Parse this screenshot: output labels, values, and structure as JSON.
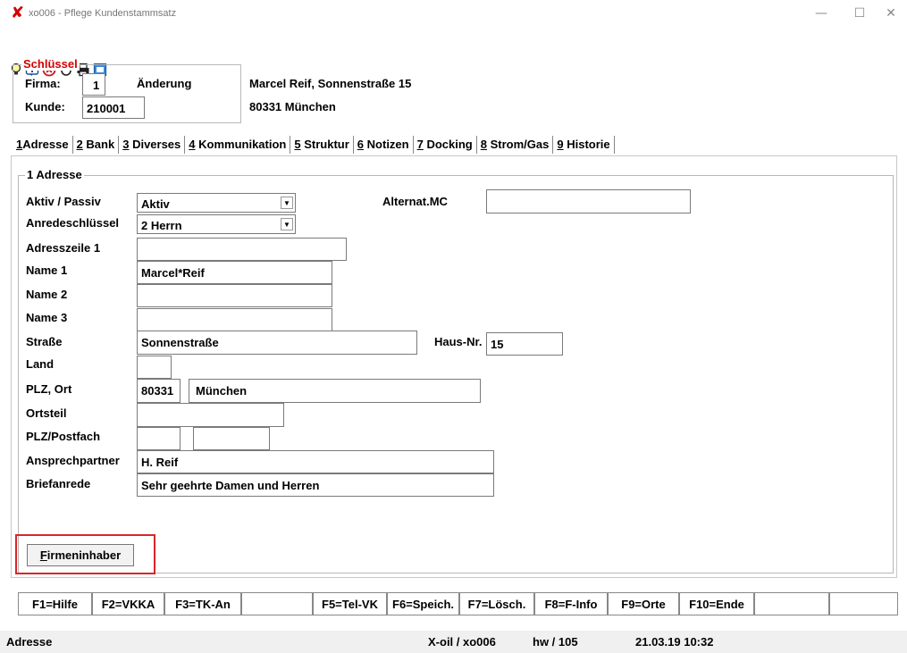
{
  "window": {
    "title": "xo006 - Pflege Kundenstammsatz",
    "minimize": "—",
    "maximize": "☐",
    "close": "✕"
  },
  "toolbar": {
    "icons": [
      "lightbulb-icon",
      "info-icon",
      "cancel-icon",
      "refresh-icon",
      "print-icon",
      "window-icon"
    ]
  },
  "key": {
    "legend": "Schlüssel",
    "firma_label": "Firma:",
    "firma_value": "1",
    "mode": "Änderung",
    "kunde_label": "Kunde:",
    "kunde_value": "210001",
    "customer_line1": "Marcel Reif, Sonnenstraße 15",
    "customer_line2": "80331 München"
  },
  "tabs": [
    {
      "num": "1",
      "label": "Adresse"
    },
    {
      "num": "2",
      "label": "Bank"
    },
    {
      "num": "3",
      "label": "Diverses"
    },
    {
      "num": "4",
      "label": "Kommunikation"
    },
    {
      "num": "5",
      "label": "Struktur"
    },
    {
      "num": "6",
      "label": "Notizen"
    },
    {
      "num": "7",
      "label": "Docking"
    },
    {
      "num": "8",
      "label": "Strom/Gas"
    },
    {
      "num": "9",
      "label": "Historie"
    }
  ],
  "address": {
    "legend": "1 Adresse",
    "aktiv_label": "Aktiv / Passiv",
    "aktiv_value": "Aktiv",
    "alternat_label": "Alternat.MC",
    "alternat_value": "",
    "anrede_label": "Anredeschlüssel",
    "anrede_value": "2 Herrn",
    "adresszeile_label": "Adresszeile 1",
    "adresszeile_value": "",
    "name1_label": "Name 1",
    "name1_value": "Marcel*Reif",
    "name2_label": "Name 2",
    "name2_value": "",
    "name3_label": "Name 3",
    "name3_value": "",
    "strasse_label": "Straße",
    "strasse_value": "Sonnenstraße",
    "hausnr_label": "Haus-Nr.",
    "hausnr_value": "15",
    "land_label": "Land",
    "land_value": "",
    "plzort_label": "PLZ, Ort",
    "plz_value": "80331",
    "ort_value": "München",
    "ortsteil_label": "Ortsteil",
    "ortsteil_value": "",
    "postfach_label": "PLZ/Postfach",
    "postfach_plz": "",
    "postfach_nr": "",
    "ansprech_label": "Ansprechpartner",
    "ansprech_value": "H. Reif",
    "briefanrede_label": "Briefanrede",
    "briefanrede_value": "Sehr geehrte Damen und Herren",
    "firmeninhaber_first": "F",
    "firmeninhaber_rest": "irmeninhaber"
  },
  "fkeys": [
    "F1=Hilfe",
    "F2=VKKA",
    "F3=TK-An",
    "",
    "F5=Tel-VK",
    "F6=Speich.",
    "F7=Lösch.",
    "F8=F-Info",
    "F9=Orte",
    "F10=Ende",
    "",
    ""
  ],
  "status": {
    "section": "Adresse",
    "program": "X-oil / xo006",
    "user": "hw / 105",
    "datetime": "21.03.19 10:32"
  },
  "colors": {
    "accent": "#d40000",
    "highlight_box": "#d9252a"
  }
}
